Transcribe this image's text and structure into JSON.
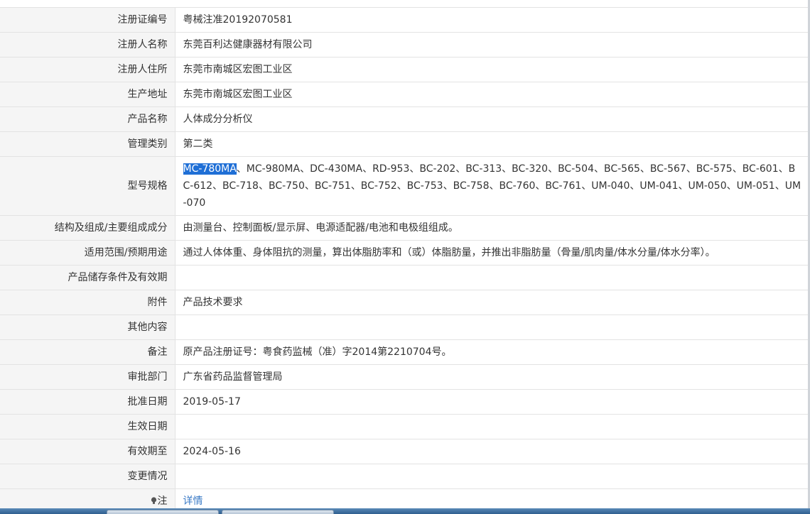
{
  "rows": [
    {
      "label": "注册证编号",
      "value": "粤械注准20192070581"
    },
    {
      "label": "注册人名称",
      "value": "东莞百利达健康器材有限公司"
    },
    {
      "label": "注册人住所",
      "value": "东莞市南城区宏图工业区"
    },
    {
      "label": "生产地址",
      "value": "东莞市南城区宏图工业区"
    },
    {
      "label": "产品名称",
      "value": "人体成分分析仪"
    },
    {
      "label": "管理类别",
      "value": "第二类"
    },
    {
      "label": "型号规格",
      "selected": "MC-780MA",
      "value": "、MC-980MA、DC-430MA、RD-953、BC-202、BC-313、BC-320、BC-504、BC-565、BC-567、BC-575、BC-601、BC-612、BC-718、BC-750、BC-751、BC-752、BC-753、BC-758、BC-760、BC-761、UM-040、UM-041、UM-050、UM-051、UM-070"
    },
    {
      "label": "结构及组成/主要组成成分",
      "value": "由测量台、控制面板/显示屏、电源适配器/电池和电极组组成。"
    },
    {
      "label": "适用范围/预期用途",
      "value": "通过人体体重、身体阻抗的测量，算出体脂肪率和（或）体脂肪量，并推出非脂肪量（骨量/肌肉量/体水分量/体水分率）。"
    },
    {
      "label": "产品储存条件及有效期",
      "value": ""
    },
    {
      "label": "附件",
      "value": "产品技术要求"
    },
    {
      "label": "其他内容",
      "value": ""
    },
    {
      "label": "备注",
      "value": "原产品注册证号：粤食药监械（准）字2014第2210704号。"
    },
    {
      "label": "审批部门",
      "value": "广东省药品监督管理局"
    },
    {
      "label": "批准日期",
      "value": "2019-05-17"
    },
    {
      "label": "生效日期",
      "value": ""
    },
    {
      "label": "有效期至",
      "value": "2024-05-16"
    },
    {
      "label": "变更情况",
      "value": ""
    },
    {
      "label": "注",
      "value": "详情",
      "icon": "lightbulb-icon"
    }
  ],
  "colors": {
    "label_bg": "#f5f5f5",
    "border": "#e3e3e3",
    "text": "#333333",
    "selection": "#1f6fd6",
    "link": "#3879c6"
  }
}
